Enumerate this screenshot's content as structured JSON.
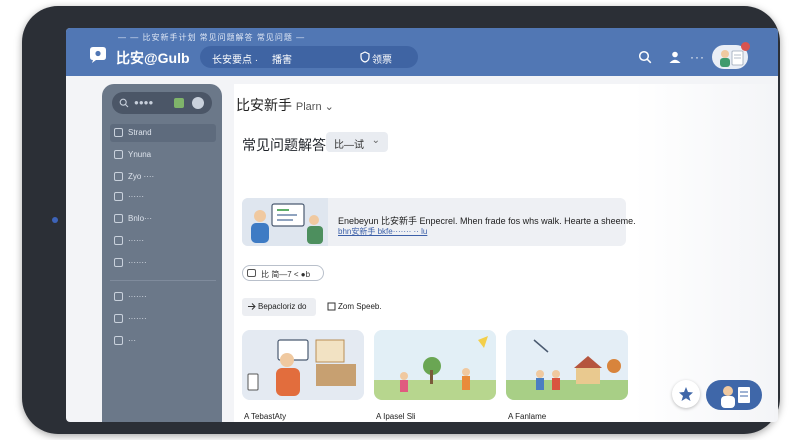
{
  "window": {
    "system_line": "— — 比安新手计划 常见问题解答 常见问题 —",
    "app_name": "比安@Gulb"
  },
  "header": {
    "pill_item_1": "长安要点 ·",
    "pill_item_2": "播害",
    "pill_item_3": "领票",
    "more": "···"
  },
  "sidebar": {
    "search_label": "●●●●",
    "items": [
      {
        "label": "Strand",
        "active": true
      },
      {
        "label": "Ynuna"
      },
      {
        "label": "Zyo ····"
      },
      {
        "label": "······"
      },
      {
        "label": "Bnlo···"
      },
      {
        "label": "······"
      },
      {
        "label": "·······"
      },
      {
        "label": "·······"
      },
      {
        "label": "·······"
      },
      {
        "label": "···"
      }
    ]
  },
  "main": {
    "plan_title": "比安新手",
    "plan_suffix": "Plarn ⌄",
    "faq_title": "常见问题解答",
    "faq_select_value": "比—试",
    "banner_text": "Enebeyun 比安新手 Enpecrel. Mhen frade fos whs walk. Hearte a sheeme.",
    "banner_link": "bhn安新手 bkfe······· ·· lu",
    "tag_label": "比 简—7 < ●b",
    "action_1": "Bepacloriz do",
    "action_2": "Zom Speeb.",
    "cards": [
      {
        "caption": "A TebastAty"
      },
      {
        "caption": "A Ipasel Sli"
      },
      {
        "caption": "A Fanlame"
      }
    ]
  },
  "colors": {
    "header": "#5177b4",
    "sidebar": "#6b7889",
    "accent": "#3f67a9"
  }
}
